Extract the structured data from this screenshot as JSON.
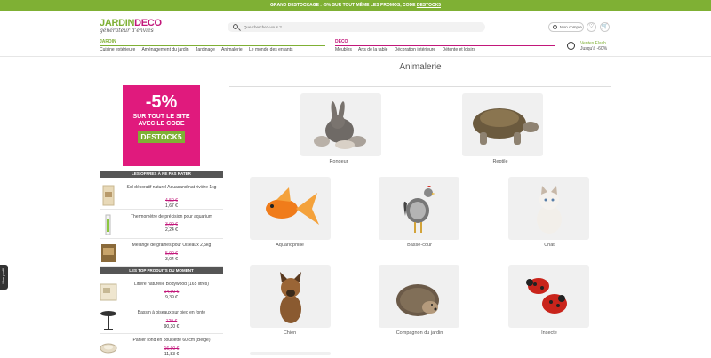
{
  "promo_bar": {
    "text": "GRAND DESTOCKAGE : -5% SUR TOUT MÊME LES PROMOS, CODE ",
    "code": "DESTOCK5"
  },
  "header": {
    "logo_green": "JARDIN",
    "logo_pink": "DECO",
    "tagline": "générateur d'envies",
    "search_placeholder": "Que cherchez-vous ?",
    "account_label": "Mon compte",
    "wishlist_icon": "heart-icon",
    "cart_icon": "cart-icon",
    "jardin": {
      "label": "JARDIN",
      "color": "#7fb034",
      "items": [
        "Cuisine extérieure",
        "Aménagement du jardin",
        "Jardinage",
        "Animalerie",
        "Le monde des enfants"
      ]
    },
    "deco": {
      "label": "DÉCO",
      "color": "#c2177a",
      "items": [
        "Meubles",
        "Arts de la table",
        "Décoration intérieure",
        "Détente et loisirs"
      ]
    },
    "ventes_flash": {
      "title": "Ventes Flash",
      "discount": "Jusqu'à -60%"
    }
  },
  "page": {
    "title": "Animalerie"
  },
  "sidebar": {
    "promo": {
      "percent": "-5%",
      "line1": "SUR TOUT LE SITE",
      "line2": "AVEC LE CODE",
      "code": "DESTOCK5"
    },
    "section1_title": "LES OFFRES À NE PAS RATER",
    "offers": [
      {
        "name": "Sol décoratif naturel Aquasand nat rivière 1kg",
        "old_price": "4,50 €",
        "new_price": "1,67 €"
      },
      {
        "name": "Thermomètre de précision pour aquarium",
        "old_price": "3,99 €",
        "new_price": "2,24 €"
      },
      {
        "name": "Mélange de graines pour Oiseaux 2,5kg",
        "old_price": "5,90 €",
        "new_price": "3,04 €"
      }
    ],
    "section2_title": "LES TOP PRODUITS DU MOMENT",
    "top": [
      {
        "name": "Litière naturelle Bodywood (165 litres)",
        "old_price": "14,90 €",
        "new_price": "9,39 €"
      },
      {
        "name": "Bassin à oiseaux sur pied en fonte",
        "old_price": "129 €",
        "new_price": "90,30 €"
      },
      {
        "name": "Panier rond en bouclette 60 cm (Beige)",
        "old_price": "16,90 €",
        "new_price": "11,83 €"
      }
    ]
  },
  "categories": [
    {
      "label": "Rongeur",
      "icon": "rabbit-image"
    },
    {
      "label": "Reptile",
      "icon": "tortoise-image"
    },
    {
      "label": "Aquariophilie",
      "icon": "goldfish-image"
    },
    {
      "label": "Basse-cour",
      "icon": "rooster-image"
    },
    {
      "label": "Chat",
      "icon": "cat-image"
    },
    {
      "label": "Chien",
      "icon": "dog-image"
    },
    {
      "label": "Compagnon du jardin",
      "icon": "hedgehog-image"
    },
    {
      "label": "Insecte",
      "icon": "ladybug-image"
    }
  ],
  "side_tab": "Mon profil"
}
